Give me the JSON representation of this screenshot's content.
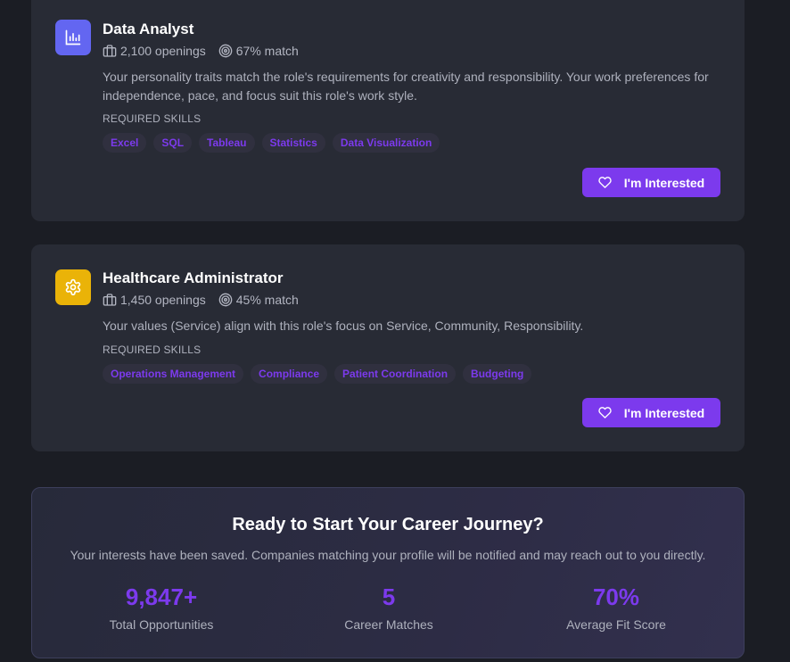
{
  "jobs": [
    {
      "title": "Data Analyst",
      "icon": "bar-chart-icon",
      "openings": "2,100 openings",
      "match": "67% match",
      "description": "Your personality traits match the role's requirements for creativity and responsibility. Your work preferences for independence, pace, and focus suit this role's work style.",
      "skills_label": "REQUIRED SKILLS",
      "skills": [
        "Excel",
        "SQL",
        "Tableau",
        "Statistics",
        "Data Visualization"
      ],
      "button_label": "I'm Interested",
      "accent": "#6366f1"
    },
    {
      "title": "Healthcare Administrator",
      "icon": "gear-icon",
      "openings": "1,450 openings",
      "match": "45% match",
      "description": "Your values (Service) align with this role's focus on Service, Community, Responsibility.",
      "skills_label": "REQUIRED SKILLS",
      "skills": [
        "Operations Management",
        "Compliance",
        "Patient Coordination",
        "Budgeting"
      ],
      "button_label": "I'm Interested",
      "accent": "#eab308"
    }
  ],
  "cta": {
    "title": "Ready to Start Your Career Journey?",
    "subtitle": "Your interests have been saved. Companies matching your profile will be notified and may reach out to you directly.",
    "stats": [
      {
        "value": "9,847+",
        "label": "Total Opportunities"
      },
      {
        "value": "5",
        "label": "Career Matches"
      },
      {
        "value": "70%",
        "label": "Average Fit Score"
      }
    ]
  },
  "colors": {
    "background": "#1b1d24",
    "card": "#282b35",
    "primary": "#7c3aed"
  }
}
